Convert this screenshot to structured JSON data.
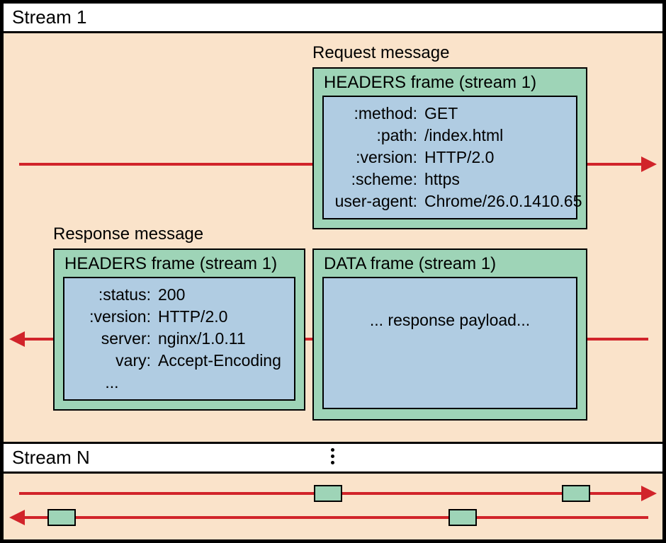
{
  "stream1": {
    "title": "Stream 1",
    "request_label": "Request message",
    "request": {
      "frame_title": "HEADERS frame (stream 1)",
      "headers": [
        {
          "key": ":method:",
          "val": "GET"
        },
        {
          "key": ":path:",
          "val": "/index.html"
        },
        {
          "key": ":version:",
          "val": "HTTP/2.0"
        },
        {
          "key": ":scheme:",
          "val": "https"
        },
        {
          "key": "user-agent:",
          "val": "Chrome/26.0.1410.65"
        }
      ]
    },
    "response_label": "Response message",
    "response_headers": {
      "frame_title": "HEADERS frame (stream 1)",
      "headers": [
        {
          "key": ":status:",
          "val": "200"
        },
        {
          "key": ":version:",
          "val": "HTTP/2.0"
        },
        {
          "key": "server:",
          "val": "nginx/1.0.11"
        },
        {
          "key": "vary:",
          "val": "Accept-Encoding"
        },
        {
          "key": "...",
          "val": ""
        }
      ]
    },
    "response_data": {
      "frame_title": "DATA frame (stream 1)",
      "payload_text": "... response payload..."
    }
  },
  "streamN": {
    "title": "Stream N"
  }
}
